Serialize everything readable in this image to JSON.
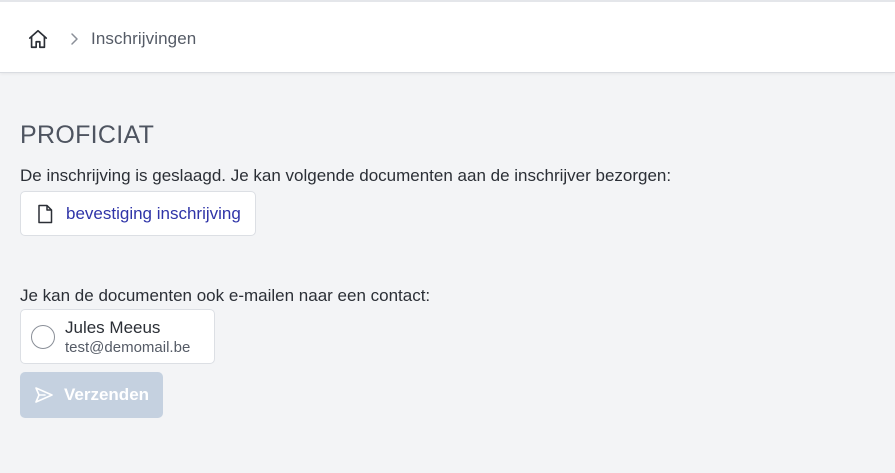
{
  "breadcrumb": {
    "home_icon": "home-icon",
    "separator_icon": "chevron-right-icon",
    "current": "Inschrijvingen"
  },
  "main": {
    "title": "PROFICIAT",
    "intro": "De inschrijving is geslaagd. Je kan volgende documenten aan de inschrijver bezorgen:",
    "documents": [
      {
        "icon": "document-icon",
        "label": "bevestiging inschrijving"
      }
    ],
    "email_intro": "Je kan de documenten ook e-mailen naar een contact:",
    "contacts": [
      {
        "name": "Jules Meeus",
        "email": "test@demomail.be",
        "selected": false
      }
    ],
    "send_button": {
      "icon": "send-icon",
      "label": "Verzenden",
      "enabled": false
    }
  },
  "colors": {
    "background": "#f3f4f6",
    "link": "#2f34a8",
    "button_disabled": "#c5d1e0",
    "title": "#4e5460"
  }
}
